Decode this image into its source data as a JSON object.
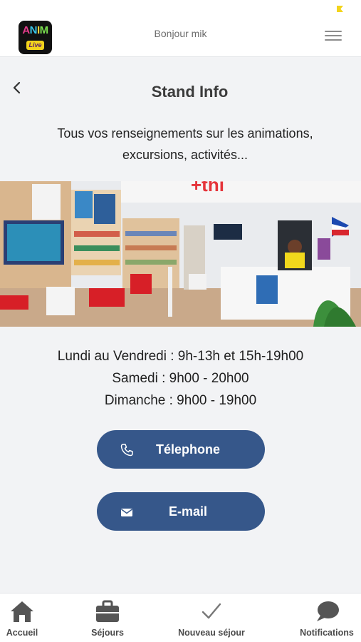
{
  "header": {
    "greeting": "Bonjour mik",
    "logo_text": "ANIM",
    "logo_sub": "Live"
  },
  "page": {
    "title": "Stand Info",
    "intro_line1": "Tous vos renseignements sur les animations,",
    "intro_line2": "excursions, activités..."
  },
  "hours": [
    "Lundi au Vendredi : 9h-13h et 15h-19h00",
    "Samedi : 9h00 - 20h00",
    "Dimanche : 9h00 - 19h00"
  ],
  "buttons": {
    "phone_label": "Télephone",
    "email_label": "E-mail"
  },
  "nav": {
    "home": "Accueil",
    "stays": "Séjours",
    "new_stay": "Nouveau séjour",
    "notifications": "Notifications"
  },
  "colors": {
    "accent": "#36578a",
    "background": "#f2f3f5"
  }
}
